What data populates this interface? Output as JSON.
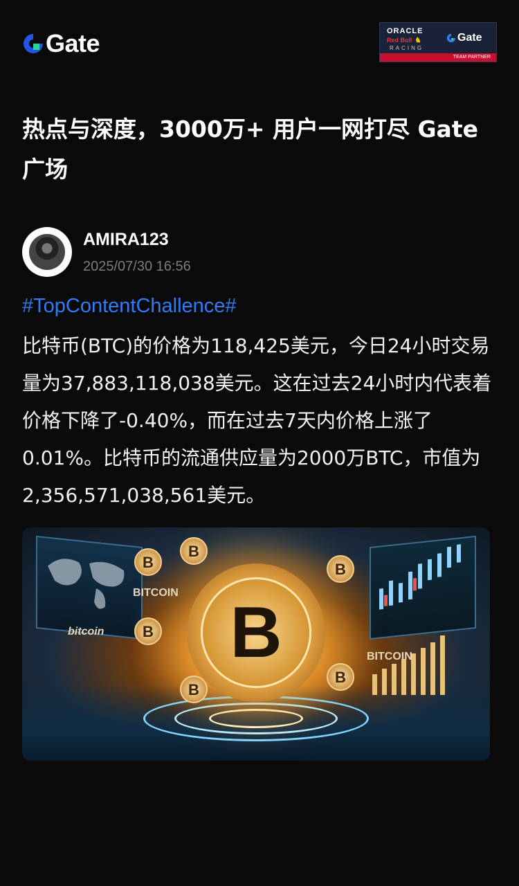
{
  "header": {
    "brand": "Gate",
    "partner_badge": {
      "oracle": "ORACLE",
      "redbull": "Red Bull",
      "racing": "RACING",
      "brand": "Gate",
      "tagline": "TEAM PARTNER"
    }
  },
  "headline": "热点与深度，3000万+ 用户一网打尽 Gate 广场",
  "post": {
    "author": "AMIRA123",
    "timestamp": "2025/07/30 16:56",
    "hashtag": "#TopContentChallence#",
    "body": "比特币(BTC)的价格为118,425美元，今日24小时交易量为37,883,118,038美元。这在过去24小时内代表着价格下降了-0.40%，而在过去7天内价格上涨了0.01%。比特币的流通供应量为2000万BTC，市值为2,356,571,038,561美元。",
    "image": {
      "labels": [
        "BITCOIN",
        "bitcoin",
        "BITCOIN"
      ],
      "coin_symbol": "B"
    }
  },
  "colors": {
    "background": "#0a0a0a",
    "hashtag": "#2f7cf6",
    "accent_blue": "#2354e6"
  }
}
